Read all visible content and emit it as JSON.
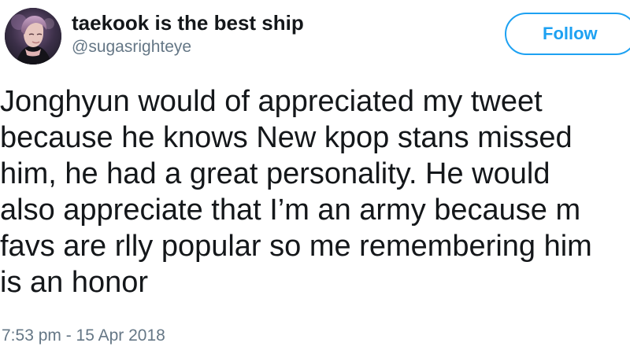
{
  "tweet": {
    "user": {
      "display_name": "taekook is the best ship",
      "handle": "@sugasrighteye",
      "avatar_icon": "profile-photo"
    },
    "follow_button_label": "Follow",
    "text_lines": [
      "Jonghyun would of appreciated my tweet",
      "because he knows New kpop stans missed",
      "him, he had a great personality. He would",
      "also appreciate that I’m an army because m",
      "favs are rlly popular so me remembering him",
      "is an honor"
    ],
    "timestamp": "7:53 pm - 15 Apr 2018"
  },
  "colors": {
    "accent": "#1da1f2",
    "text": "#14171a",
    "secondary_text": "#657786"
  }
}
